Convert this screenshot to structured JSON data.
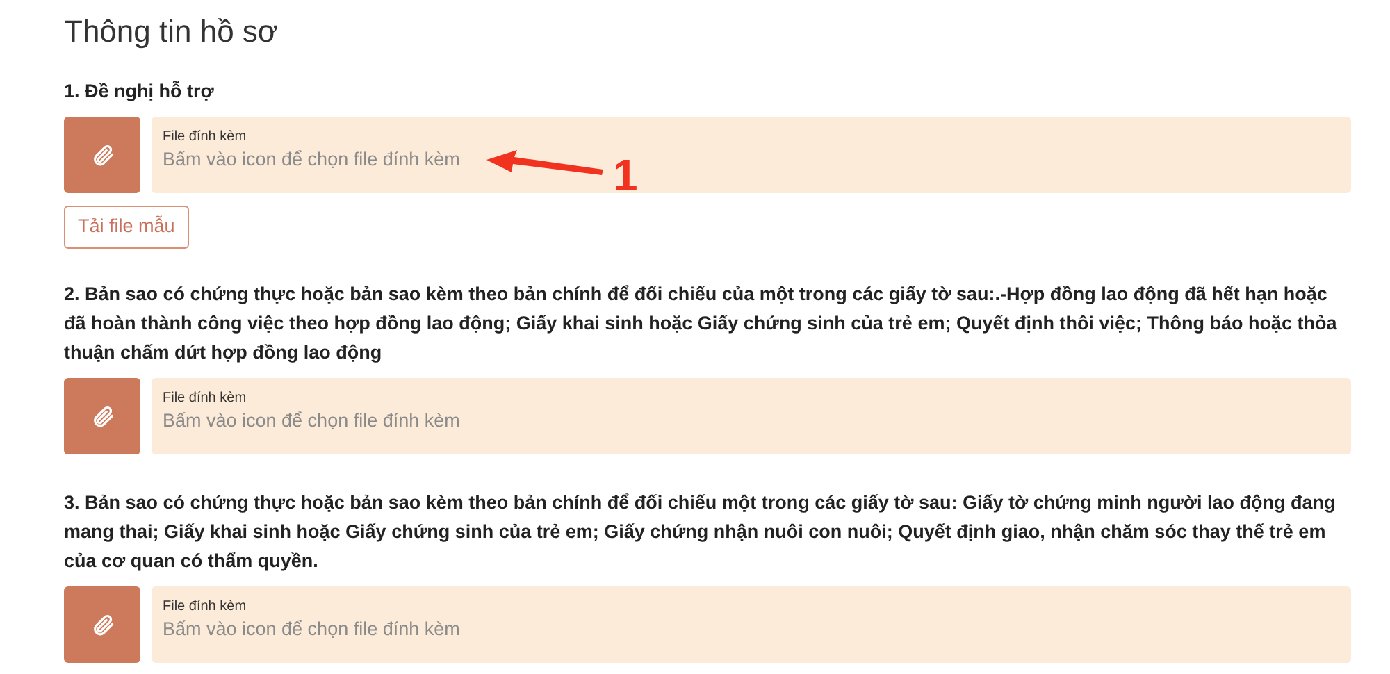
{
  "title": "Thông tin hồ sơ",
  "sections": [
    {
      "label": "1. Đề nghị hỗ trợ",
      "attachment": {
        "label": "File đính kèm",
        "placeholder": "Bấm vào icon để chọn file đính kèm"
      },
      "template_button": "Tải file mẫu"
    },
    {
      "label": "2. Bản sao có chứng thực hoặc bản sao kèm theo bản chính để đối chiếu của một trong các giấy tờ sau:.-Hợp đồng lao động đã hết hạn hoặc đã hoàn thành công việc theo hợp đồng lao động; Giấy khai sinh hoặc Giấy chứng sinh của trẻ em; Quyết định thôi việc; Thông báo hoặc thỏa thuận chấm dứt hợp đồng lao động",
      "attachment": {
        "label": "File đính kèm",
        "placeholder": "Bấm vào icon để chọn file đính kèm"
      }
    },
    {
      "label": "3. Bản sao có chứng thực hoặc bản sao kèm theo bản chính để đối chiếu một trong các giấy tờ sau: Giấy tờ chứng minh người lao động đang mang thai; Giấy khai sinh hoặc Giấy chứng sinh của trẻ em; Giấy chứng nhận nuôi con nuôi; Quyết định giao, nhận chăm sóc thay thế trẻ em của cơ quan có thẩm quyền.",
      "attachment": {
        "label": "File đính kèm",
        "placeholder": "Bấm vào icon để chọn file đính kèm"
      }
    }
  ],
  "annotation": {
    "number": "1"
  }
}
